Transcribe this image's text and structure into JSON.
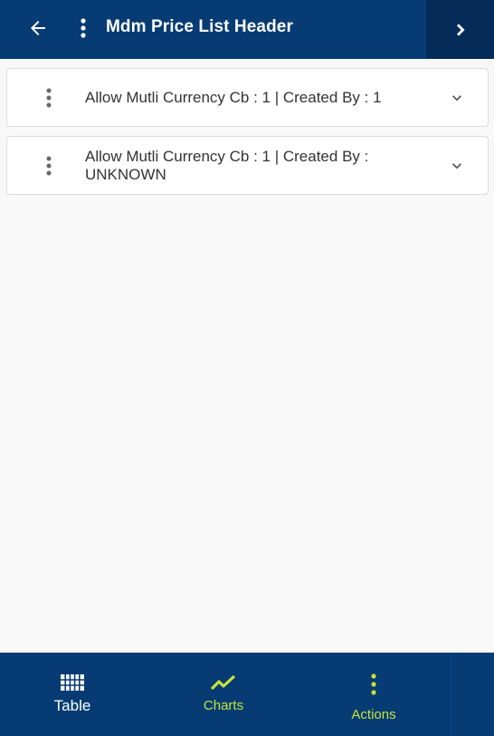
{
  "header": {
    "title": "Mdm Price List Header",
    "back_icon": "arrow-left-icon",
    "menu_icon": "more-vertical-icon",
    "next_icon": "chevron-right-icon"
  },
  "cards": [
    {
      "text": "Allow Mutli Currency Cb  : 1 | Created By  : 1"
    },
    {
      "text": "Allow Mutli Currency Cb  : 1 | Created By  : UNKNOWN"
    }
  ],
  "bottom_nav": {
    "table_label": "Table",
    "charts_label": "Charts",
    "actions_label": "Actions"
  },
  "colors": {
    "primary": "#063b73",
    "accent": "#c6e33c",
    "background": "#f8f8f8"
  }
}
